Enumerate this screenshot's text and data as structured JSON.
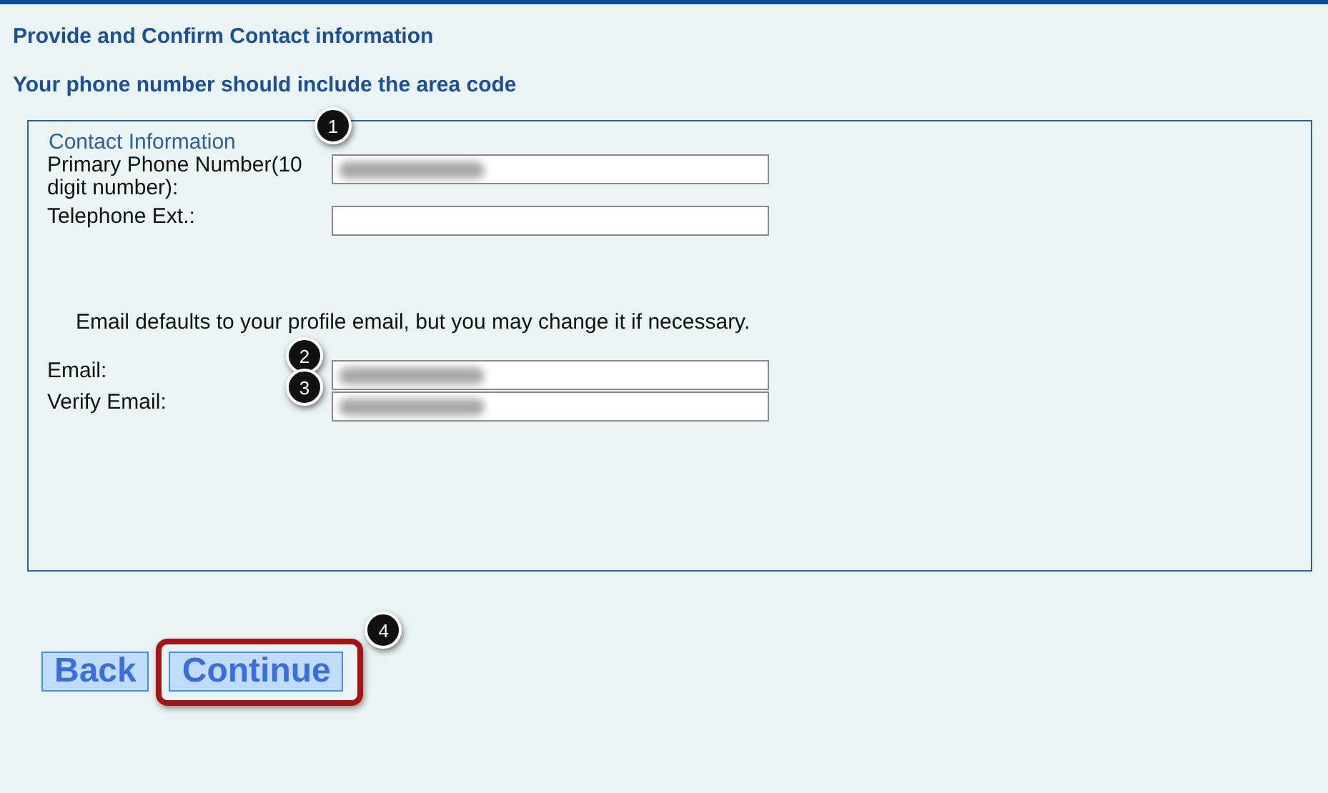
{
  "heading": "Provide and Confirm Contact information",
  "subheading": "Your phone number should include the area code",
  "fieldset": {
    "legend": "Contact Information",
    "phone_fields": [
      {
        "label": "Primary Phone Number(10 digit number):",
        "redacted": true,
        "callout": "1"
      },
      {
        "label": "Telephone Ext.:",
        "redacted": false
      }
    ],
    "note": "Email defaults to your profile email, but you may change it if necessary.",
    "email_fields": [
      {
        "label": "Email:",
        "redacted": true,
        "callout": "2"
      },
      {
        "label": "Verify Email:",
        "redacted": true,
        "callout": "3"
      }
    ]
  },
  "buttons": [
    {
      "label": "Back",
      "highlighted": false
    },
    {
      "label": "Continue",
      "highlighted": true,
      "callout": "4"
    }
  ]
}
